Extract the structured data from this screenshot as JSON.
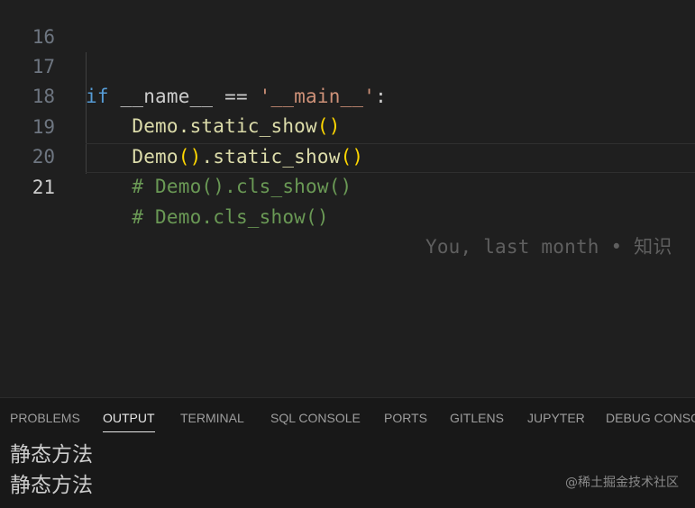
{
  "editor": {
    "lines": [
      {
        "number": "16",
        "content": ""
      },
      {
        "number": "17",
        "tokens": {
          "kw": "if",
          "t1": " __name__ == ",
          "str": "'__main__'",
          "t2": ":"
        }
      },
      {
        "number": "18",
        "tokens": {
          "indent": "    ",
          "t1": "Demo.static_show",
          "open": "(",
          "close": ")"
        }
      },
      {
        "number": "19",
        "tokens": {
          "indent": "    ",
          "t1": "Demo",
          "open1": "(",
          "close1": ")",
          "t2": ".static_show",
          "open2": "(",
          "close2": ")"
        }
      },
      {
        "number": "20",
        "tokens": {
          "indent": "    ",
          "comment": "# Demo().cls_show()"
        }
      },
      {
        "number": "21",
        "tokens": {
          "indent": "    ",
          "comment": "# Demo.cls_show()",
          "blame": "You, last month • 知识"
        }
      }
    ]
  },
  "panel": {
    "tabs": [
      "PROBLEMS",
      "OUTPUT",
      "TERMINAL",
      "SQL CONSOLE",
      "PORTS",
      "GITLENS",
      "JUPYTER",
      "DEBUG CONSO"
    ],
    "active_tab": "OUTPUT",
    "output": [
      "静态方法",
      "静态方法"
    ]
  },
  "watermark": "@稀土掘金技术社区",
  "colors": {
    "background": "#1f1f1f",
    "keyword": "#569cd6",
    "string": "#ce9178",
    "bracket": "#ffd700",
    "comment": "#6a9955"
  }
}
